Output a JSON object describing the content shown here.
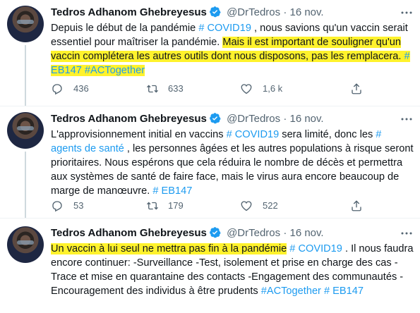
{
  "author": {
    "name": "Tedros Adhanom Ghebreyesus",
    "handle": "@DrTedros",
    "dot": "·"
  },
  "tweets": [
    {
      "date": "16 nov.",
      "parts": [
        "Depuis le début de la pandémie ",
        "# COVID19",
        " , nous savions qu'un vaccin serait essentiel pour maîtriser la pandémie. ",
        "Mais il est important de souligner qu'un vaccin complétera les autres outils dont nous disposons, pas les remplacera.",
        " ",
        "# EB147",
        " ",
        "#ACTogether"
      ],
      "replies": "436",
      "retweets": "633",
      "likes": "1,6 k"
    },
    {
      "date": "16 nov.",
      "parts": [
        "L'approvisionnement initial en vaccins ",
        "# COVID19",
        " sera limité, donc les ",
        "# agents de santé",
        " , les personnes âgées et les autres populations à risque seront prioritaires. Nous espérons que cela réduira le nombre de décès et permettra aux systèmes de santé de faire face, mais le virus aura encore beaucoup de marge de manœuvre. ",
        "# EB147"
      ],
      "replies": "53",
      "retweets": "179",
      "likes": "522"
    },
    {
      "date": "16 nov.",
      "parts": [
        "Un vaccin à lui seul ne mettra pas fin à la pandémie",
        " ",
        "# COVID19",
        " . Il nous faudra encore continuer: -Surveillance -Test, isolement et prise en charge des cas -Trace et mise en quarantaine des contacts -Engagement des communautés -Encouragement des individus à être prudents ",
        "#ACTogether",
        " ",
        "# EB147"
      ]
    }
  ],
  "colors": {
    "highlight": "#fff22c",
    "link": "#1d9bf0",
    "muted": "#536471",
    "verified": "#1d9bf0"
  },
  "icons": [
    "more-icon",
    "verified-icon",
    "reply-icon",
    "retweet-icon",
    "like-icon",
    "share-icon"
  ]
}
